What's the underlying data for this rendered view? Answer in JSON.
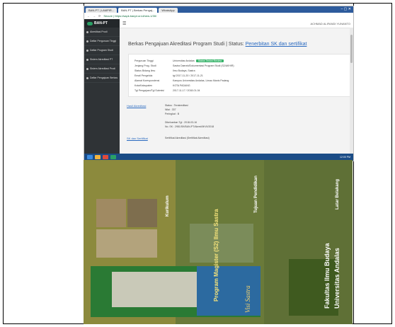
{
  "browser": {
    "tabs": [
      "BAN-PT | LAMPIR...",
      "BAN-PT | Berkas Pengaj...",
      "WhatsApp"
    ],
    "address": "Secure | https://sapk.banpt.or.id/new-1/30/",
    "window_controls": "–  ▢  ✕"
  },
  "app": {
    "brand": "BAN-PT",
    "user": "ACHMAD ALIFANDI YUNANTO",
    "sidebar": [
      "Akreditasi Prodi",
      "Daftar Perguruan Tinggi",
      "Daftar Program Studi",
      "Sistem Akreditasi PT",
      "Sistem Akreditasi Prodi",
      "Daftar Pengajuan Berkas"
    ],
    "page_title": "Berkas Pengajuan Akreditasi Program Studi",
    "page_title_sep": " | Status: ",
    "page_title_status": "Penerbitan SK dan sertifikat",
    "details": [
      {
        "k": "Perguruan Tinggi",
        "v": "Universitas Andalas",
        "badge": "Status Terkini Review"
      },
      {
        "k": "Jenjang Prog. Studi",
        "v": "Sastra Daerah/Dokumentasi Program Studi (S2/AKHIR)"
      },
      {
        "k": "Status Bidang Ilmu",
        "v": "Ilmu Budaya, Sastra"
      },
      {
        "k": "Email Pengelola",
        "v": "tgl 2017-11-20 / 2017-11-21"
      },
      {
        "k": "Alamat Korespondensi",
        "v": "Kampus Universitas Andalas, Limau Manis Padang"
      },
      {
        "k": "Kota/Kabupaten",
        "v": "KOTA PADANG"
      },
      {
        "k": "Tgl Pengajuan/Tgl Submisi",
        "v": "2017-11-17 / 2018-01-04"
      }
    ],
    "result_head": "Hasil Akreditasi",
    "result": [
      "Status : Terakreditasi",
      "Nilai : 337",
      "Peringkat : B",
      "",
      "Dikeluarkan Tgl : 2018-03-16",
      "No. SK : 2981/SK/BAN-PT/Akred/M/VII/2018"
    ],
    "sk_head": "SK dan Sertifikat",
    "sk_text": "Sertifikat Akreditasi (Sertifikat Akreditasi)",
    "clock": "12:00 PM"
  },
  "brochure": {
    "texts": [
      "Program Magister (S2) Ilmu Sastra",
      "Fakultas Ilmu Budaya",
      "Universitas Andalas",
      "Visi Sastra",
      "Tujuan Pendidikan",
      "Latar Belakang",
      "Kurikulum"
    ]
  }
}
